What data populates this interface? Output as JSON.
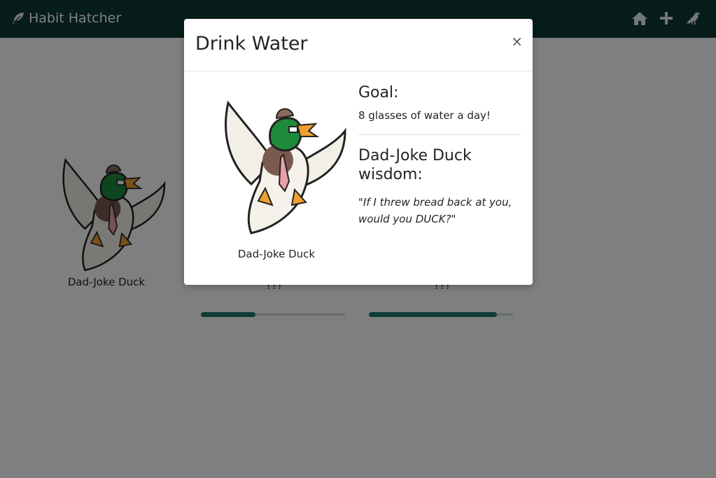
{
  "navbar": {
    "brand": "Habit Hatcher",
    "icons": [
      "feather-icon",
      "home-icon",
      "plus-icon",
      "bird-icon"
    ]
  },
  "background_cards": [
    {
      "label": "Dad-Joke Duck"
    },
    {
      "label": "???",
      "progress": 0.38
    },
    {
      "label": "???",
      "progress": 0.89
    }
  ],
  "modal": {
    "title": "Drink Water",
    "close": "×",
    "duck_name": "Dad-Joke Duck",
    "goal_heading": "Goal:",
    "goal_text": "8 glasses of water a day!",
    "wisdom_heading": "Dad-Joke Duck wisdom:",
    "wisdom_text": "\"If I threw bread back at you, would you DUCK?\""
  },
  "colors": {
    "navbar": "#0f3b36",
    "progress_fill": "#1f7a70",
    "backdrop": "rgba(0,0,0,0.5)"
  }
}
